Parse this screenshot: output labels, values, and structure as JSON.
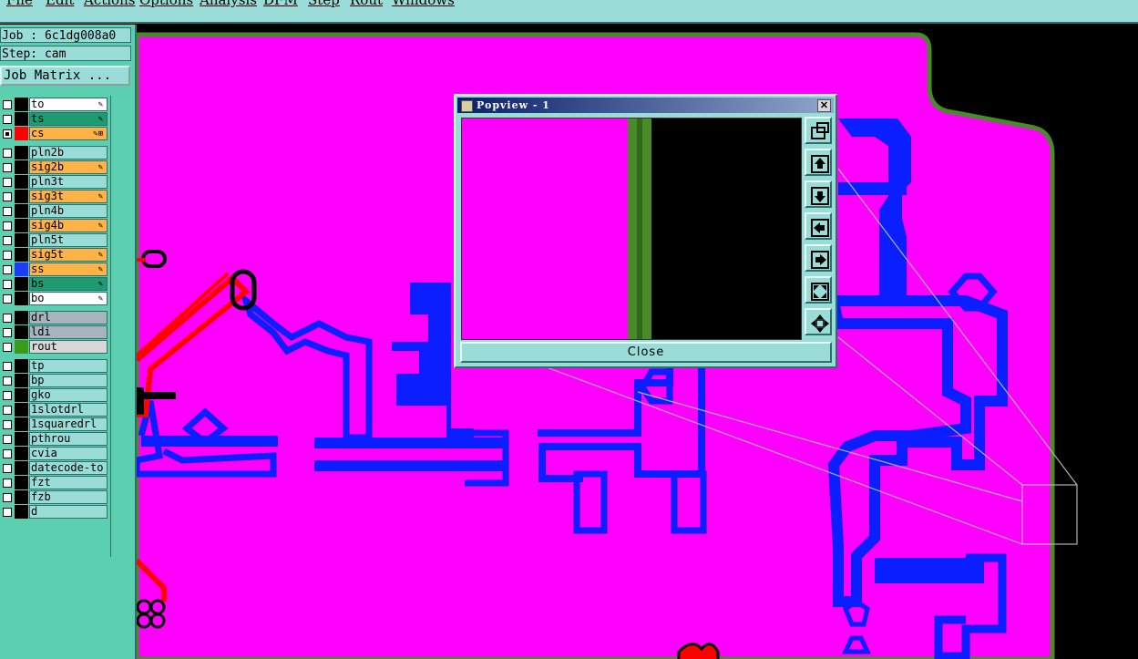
{
  "menu": [
    "File",
    "Edit",
    "Actions",
    "Options",
    "Analysis",
    "DFM",
    "Step",
    "Rout",
    "Windows"
  ],
  "job": {
    "label": "Job : 6c1dg008a0",
    "step": "Step: cam",
    "matrix_button": "Job Matrix ..."
  },
  "layers": [
    {
      "name": "to",
      "bg": "#ffffff",
      "mark": "#000000",
      "flag": "✎",
      "group": 1
    },
    {
      "name": "ts",
      "bg": "#1f9b72",
      "mark": "#000000",
      "flag": "✎",
      "group": 1
    },
    {
      "name": "cs",
      "bg": "#ffb347",
      "mark": "#ff0000",
      "flag": "✎⊞",
      "group": 1,
      "active": true
    },
    {
      "name": "pln2b",
      "bg": "#9adcd8",
      "mark": "#000000",
      "flag": "",
      "group": 2
    },
    {
      "name": "sig2b",
      "bg": "#ffb347",
      "mark": "#000000",
      "flag": "✎",
      "group": 2
    },
    {
      "name": "pln3t",
      "bg": "#9adcd8",
      "mark": "#000000",
      "flag": "",
      "group": 2
    },
    {
      "name": "sig3t",
      "bg": "#ffb347",
      "mark": "#000000",
      "flag": "✎",
      "group": 2
    },
    {
      "name": "pln4b",
      "bg": "#9adcd8",
      "mark": "#000000",
      "flag": "",
      "group": 2
    },
    {
      "name": "sig4b",
      "bg": "#ffb347",
      "mark": "#000000",
      "flag": "✎",
      "group": 2
    },
    {
      "name": "pln5t",
      "bg": "#9adcd8",
      "mark": "#000000",
      "flag": "",
      "group": 2
    },
    {
      "name": "sig5t",
      "bg": "#ffb347",
      "mark": "#000000",
      "flag": "✎",
      "group": 2
    },
    {
      "name": "ss",
      "bg": "#ffb347",
      "mark": "#1a3cff",
      "flag": "✎",
      "group": 2
    },
    {
      "name": "bs",
      "bg": "#1f9b72",
      "mark": "#000000",
      "flag": "✎",
      "group": 2
    },
    {
      "name": "bo",
      "bg": "#ffffff",
      "mark": "#000000",
      "flag": "✎",
      "group": 2
    },
    {
      "name": "drl",
      "bg": "#a6b4bd",
      "mark": "#000000",
      "flag": "",
      "group": 3
    },
    {
      "name": "ldi",
      "bg": "#a6b4bd",
      "mark": "#000000",
      "flag": "",
      "group": 3
    },
    {
      "name": "rout",
      "bg": "#d8d8d8",
      "mark": "#3a9a1a",
      "flag": "",
      "group": 3
    },
    {
      "name": "tp",
      "bg": "#9adcd8",
      "mark": "#000000",
      "flag": "",
      "group": 4
    },
    {
      "name": "bp",
      "bg": "#9adcd8",
      "mark": "#000000",
      "flag": "",
      "group": 4
    },
    {
      "name": "gko",
      "bg": "#9adcd8",
      "mark": "#000000",
      "flag": "",
      "group": 4
    },
    {
      "name": "1slotdrl",
      "bg": "#9adcd8",
      "mark": "#000000",
      "flag": "",
      "group": 4
    },
    {
      "name": "1squaredrl",
      "bg": "#9adcd8",
      "mark": "#000000",
      "flag": "",
      "group": 4
    },
    {
      "name": "pthrou",
      "bg": "#9adcd8",
      "mark": "#000000",
      "flag": "",
      "group": 4
    },
    {
      "name": "cvia",
      "bg": "#9adcd8",
      "mark": "#000000",
      "flag": "",
      "group": 4
    },
    {
      "name": "datecode-to",
      "bg": "#9adcd8",
      "mark": "#000000",
      "flag": "",
      "group": 4
    },
    {
      "name": "fzt",
      "bg": "#9adcd8",
      "mark": "#000000",
      "flag": "",
      "group": 4
    },
    {
      "name": "fzb",
      "bg": "#9adcd8",
      "mark": "#000000",
      "flag": "",
      "group": 4
    },
    {
      "name": "d",
      "bg": "#9adcd8",
      "mark": "#000000",
      "flag": "",
      "group": 4
    }
  ],
  "popview": {
    "title": "Popview - 1",
    "close_x": "✕",
    "close_label": "Close",
    "tools": [
      "zoom-fit-icon",
      "pan-up-icon",
      "pan-down-icon",
      "pan-left-icon",
      "pan-right-icon",
      "zoom-in-icon",
      "zoom-out-icon"
    ]
  },
  "colors": {
    "board": "#ff00ff",
    "trace": "#0a1eff",
    "signal": "#ff0000",
    "outline": "#4a8a2a",
    "panel": "#5bcfb0",
    "ui": "#9adcd8"
  }
}
